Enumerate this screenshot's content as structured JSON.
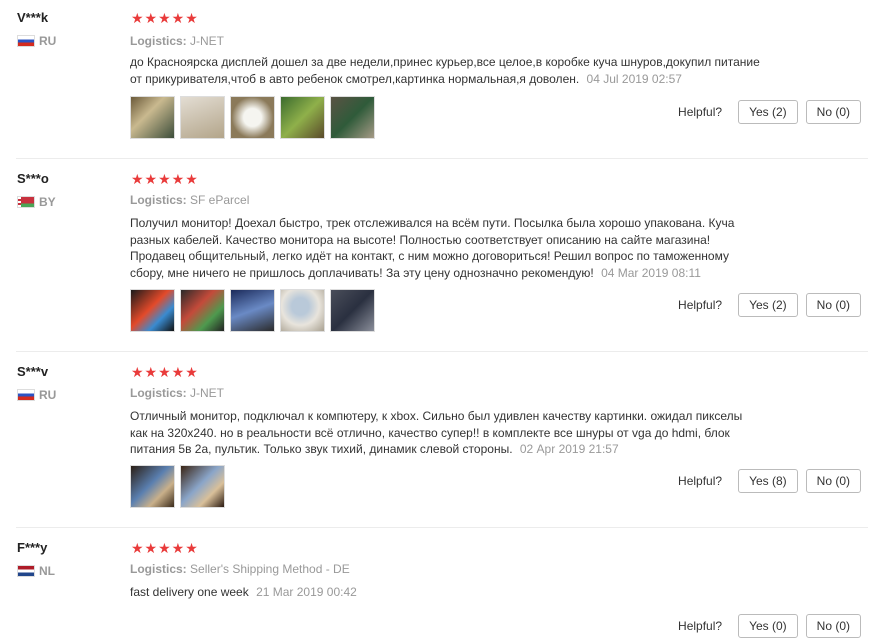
{
  "colors": {
    "star": "#e93b3b",
    "muted": "#999999",
    "divider": "#ececec"
  },
  "reviews": [
    {
      "user": "V***k",
      "country": "RU",
      "flag": "ru",
      "stars": "★★★★★",
      "logistics_label": "Logistics:",
      "logistics": "J-NET",
      "text": "до Красноярска дисплей дошел за две недели,принес курьер,все целое,в коробке куча шнуров,докупил питание от прикуривателя,чтоб в авто ребенок смотрел,картинка нормальная,я доволен.",
      "date": "04 Jul 2019 02:57",
      "thumb_count": 5,
      "helpful_label": "Helpful?",
      "yes": "Yes (2)",
      "no": "No (0)"
    },
    {
      "user": "S***o",
      "country": "BY",
      "flag": "by",
      "stars": "★★★★★",
      "logistics_label": "Logistics:",
      "logistics": "SF eParcel",
      "text": "Получил монитор! Доехал быстро, трек отслеживался на всём пути. Посылка была хорошо упакована. Куча разных кабелей. Качество монитора на высоте! Полностью соответствует описанию на сайте магазина! Продавец общительный, легко идёт на контакт, с ним можно договориться! Решил вопрос по таможенному сбору, мне ничего не пришлось доплачивать! За эту цену однозначно рекомендую!",
      "date": "04 Mar 2019 08:11",
      "thumb_count": 5,
      "helpful_label": "Helpful?",
      "yes": "Yes (2)",
      "no": "No (0)"
    },
    {
      "user": "S***v",
      "country": "RU",
      "flag": "ru",
      "stars": "★★★★★",
      "logistics_label": "Logistics:",
      "logistics": "J-NET",
      "text": "Отличный монитор, подключал к компютеру, к xbox. Сильно был удивлен качеству картинки. ожидал пикселы как на 320x240. но в реальности всё отлично, качество супер!! в комплекте все шнуры от vga до hdmi, блок питания 5в 2а, пультик. Только звук тихий, динамик слевой стороны.",
      "date": "02 Apr 2019 21:57",
      "thumb_count": 2,
      "helpful_label": "Helpful?",
      "yes": "Yes (8)",
      "no": "No (0)"
    },
    {
      "user": "F***y",
      "country": "NL",
      "flag": "nl",
      "stars": "★★★★★",
      "logistics_label": "Logistics:",
      "logistics": "Seller's Shipping Method - DE",
      "text": "fast delivery one week",
      "date": "21 Mar 2019 00:42",
      "thumb_count": 0,
      "helpful_label": "Helpful?",
      "yes": "Yes (0)",
      "no": "No (0)"
    }
  ]
}
